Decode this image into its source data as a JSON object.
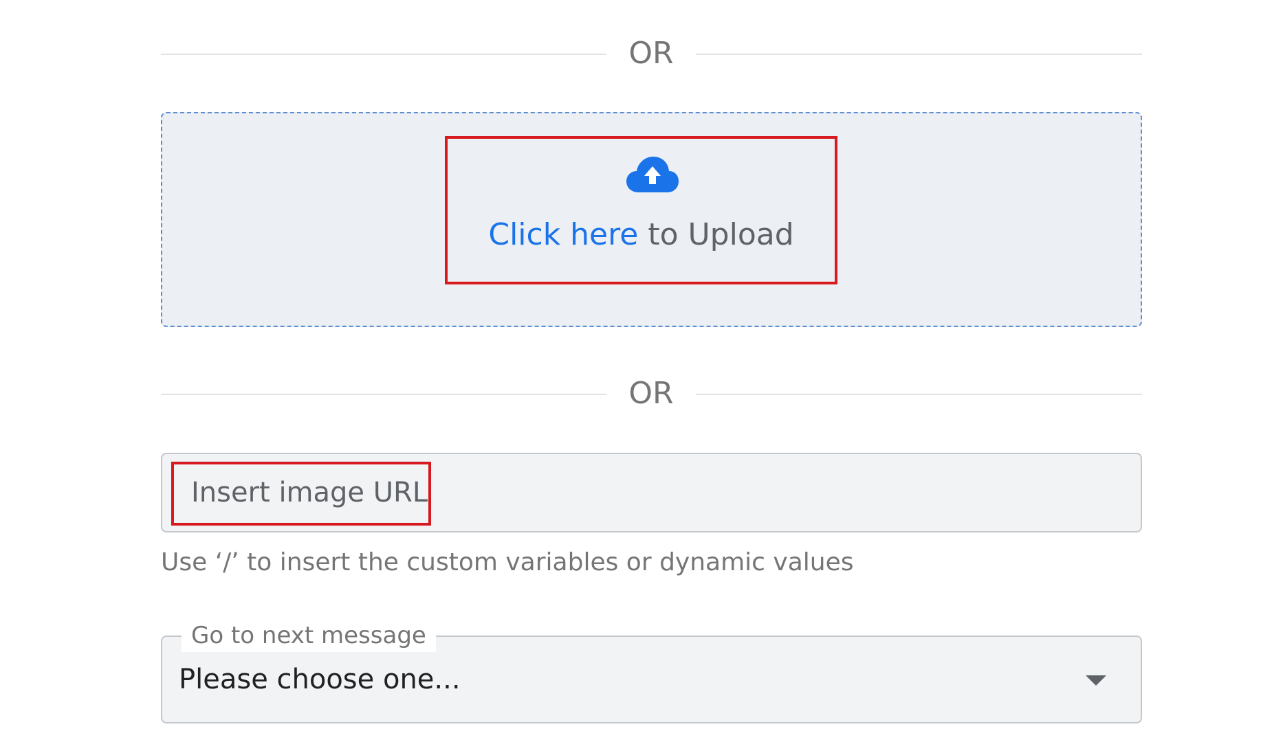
{
  "dividers": {
    "first": "OR",
    "second": "OR"
  },
  "upload": {
    "icon": "cloud-upload-icon",
    "link_text": "Click here",
    "rest_text": " to Upload",
    "accent_color": "#1a73e8"
  },
  "url_input": {
    "placeholder": "Insert image URL",
    "value": "",
    "helper_text": "Use ‘/’ to insert the custom variables or dynamic values"
  },
  "next_message": {
    "label": "Go to next message",
    "selected": "Please choose one..."
  },
  "colors": {
    "highlight": "#d71920",
    "dropzone_bg": "#eceff4",
    "dropzone_border": "#5b8fd1"
  }
}
